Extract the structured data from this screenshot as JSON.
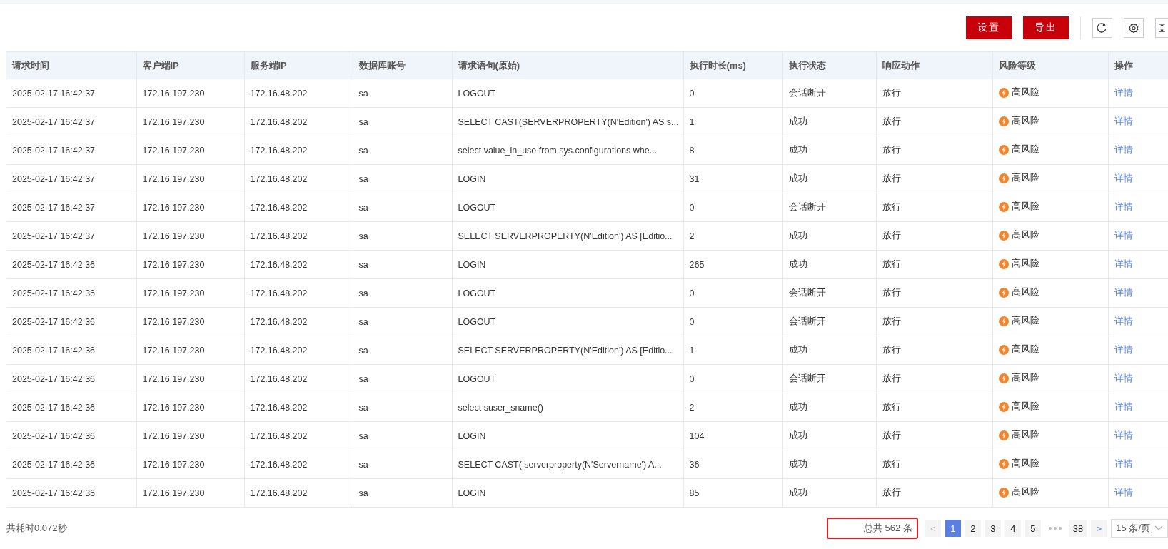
{
  "toolbar": {
    "buttons": [
      "设置",
      "导出"
    ]
  },
  "table": {
    "columns": [
      "请求时间",
      "客户端IP",
      "服务端IP",
      "数据库账号",
      "请求语句(原始)",
      "执行时长(ms)",
      "执行状态",
      "响应动作",
      "风险等级",
      "操作"
    ],
    "rows": [
      {
        "time": "2025-02-17 16:42:37",
        "client_ip": "172.16.197.230",
        "server_ip": "172.16.48.202",
        "account": "sa",
        "statement": "LOGOUT",
        "duration": "0",
        "status": "会话断开",
        "action": "放行",
        "risk": "高风险",
        "operation": "详情"
      },
      {
        "time": "2025-02-17 16:42:37",
        "client_ip": "172.16.197.230",
        "server_ip": "172.16.48.202",
        "account": "sa",
        "statement": "SELECT CAST(SERVERPROPERTY(N'Edition') AS s...",
        "duration": "1",
        "status": "成功",
        "action": "放行",
        "risk": "高风险",
        "operation": "详情"
      },
      {
        "time": "2025-02-17 16:42:37",
        "client_ip": "172.16.197.230",
        "server_ip": "172.16.48.202",
        "account": "sa",
        "statement": "select value_in_use from sys.configurations whe...",
        "duration": "8",
        "status": "成功",
        "action": "放行",
        "risk": "高风险",
        "operation": "详情"
      },
      {
        "time": "2025-02-17 16:42:37",
        "client_ip": "172.16.197.230",
        "server_ip": "172.16.48.202",
        "account": "sa",
        "statement": "LOGIN",
        "duration": "31",
        "status": "成功",
        "action": "放行",
        "risk": "高风险",
        "operation": "详情"
      },
      {
        "time": "2025-02-17 16:42:37",
        "client_ip": "172.16.197.230",
        "server_ip": "172.16.48.202",
        "account": "sa",
        "statement": "LOGOUT",
        "duration": "0",
        "status": "会话断开",
        "action": "放行",
        "risk": "高风险",
        "operation": "详情"
      },
      {
        "time": "2025-02-17 16:42:37",
        "client_ip": "172.16.197.230",
        "server_ip": "172.16.48.202",
        "account": "sa",
        "statement": "SELECT SERVERPROPERTY(N'Edition') AS [Editio...",
        "duration": "2",
        "status": "成功",
        "action": "放行",
        "risk": "高风险",
        "operation": "详情"
      },
      {
        "time": "2025-02-17 16:42:36",
        "client_ip": "172.16.197.230",
        "server_ip": "172.16.48.202",
        "account": "sa",
        "statement": "LOGIN",
        "duration": "265",
        "status": "成功",
        "action": "放行",
        "risk": "高风险",
        "operation": "详情"
      },
      {
        "time": "2025-02-17 16:42:36",
        "client_ip": "172.16.197.230",
        "server_ip": "172.16.48.202",
        "account": "sa",
        "statement": "LOGOUT",
        "duration": "0",
        "status": "会话断开",
        "action": "放行",
        "risk": "高风险",
        "operation": "详情"
      },
      {
        "time": "2025-02-17 16:42:36",
        "client_ip": "172.16.197.230",
        "server_ip": "172.16.48.202",
        "account": "sa",
        "statement": "LOGOUT",
        "duration": "0",
        "status": "会话断开",
        "action": "放行",
        "risk": "高风险",
        "operation": "详情"
      },
      {
        "time": "2025-02-17 16:42:36",
        "client_ip": "172.16.197.230",
        "server_ip": "172.16.48.202",
        "account": "sa",
        "statement": "SELECT SERVERPROPERTY(N'Edition') AS [Editio...",
        "duration": "1",
        "status": "成功",
        "action": "放行",
        "risk": "高风险",
        "operation": "详情"
      },
      {
        "time": "2025-02-17 16:42:36",
        "client_ip": "172.16.197.230",
        "server_ip": "172.16.48.202",
        "account": "sa",
        "statement": "LOGOUT",
        "duration": "0",
        "status": "会话断开",
        "action": "放行",
        "risk": "高风险",
        "operation": "详情"
      },
      {
        "time": "2025-02-17 16:42:36",
        "client_ip": "172.16.197.230",
        "server_ip": "172.16.48.202",
        "account": "sa",
        "statement": "select suser_sname()",
        "duration": "2",
        "status": "成功",
        "action": "放行",
        "risk": "高风险",
        "operation": "详情"
      },
      {
        "time": "2025-02-17 16:42:36",
        "client_ip": "172.16.197.230",
        "server_ip": "172.16.48.202",
        "account": "sa",
        "statement": "LOGIN",
        "duration": "104",
        "status": "成功",
        "action": "放行",
        "risk": "高风险",
        "operation": "详情"
      },
      {
        "time": "2025-02-17 16:42:36",
        "client_ip": "172.16.197.230",
        "server_ip": "172.16.48.202",
        "account": "sa",
        "statement": "SELECT CAST( serverproperty(N'Servername') A...",
        "duration": "36",
        "status": "成功",
        "action": "放行",
        "risk": "高风险",
        "operation": "详情"
      },
      {
        "time": "2025-02-17 16:42:36",
        "client_ip": "172.16.197.230",
        "server_ip": "172.16.48.202",
        "account": "sa",
        "statement": "LOGIN",
        "duration": "85",
        "status": "成功",
        "action": "放行",
        "risk": "高风险",
        "operation": "详情"
      }
    ]
  },
  "footer": {
    "elapsed": "共耗时0.072秒",
    "pagination": {
      "total": "总共 562 条",
      "prev": "<",
      "pages": [
        {
          "label": "1",
          "selected": true
        },
        {
          "label": "2",
          "selected": false
        },
        {
          "label": "3",
          "selected": false
        },
        {
          "label": "4",
          "selected": false
        },
        {
          "label": "5",
          "selected": false
        },
        {
          "kind": "ellipsis"
        },
        {
          "label": "38",
          "selected": false
        }
      ],
      "next": ">",
      "page_size": "15 条/页"
    }
  }
}
